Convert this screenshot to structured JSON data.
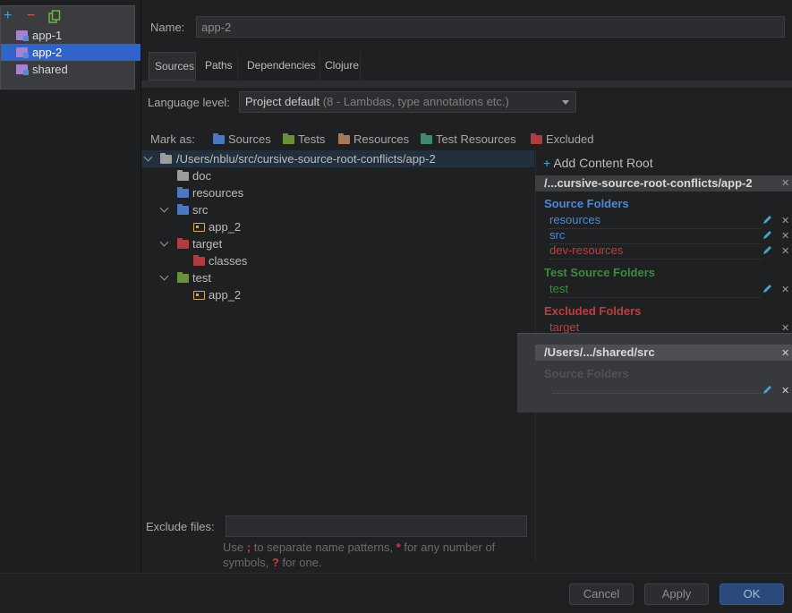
{
  "sidebar": {
    "add_glyph": "+",
    "remove_glyph": "−",
    "modules": [
      {
        "label": "app-1",
        "selected": false
      },
      {
        "label": "app-2",
        "selected": true
      },
      {
        "label": "shared",
        "selected": false
      }
    ]
  },
  "header": {
    "name_label": "Name:",
    "name_value": "app-2"
  },
  "tabs": [
    "Sources",
    "Paths",
    "Dependencies",
    "Clojure"
  ],
  "language": {
    "label": "Language level:",
    "value": "Project default",
    "hint": "(8 - Lambdas, type annotations etc.)"
  },
  "mark_as": {
    "label": "Mark as:",
    "sources": "Sources",
    "tests": "Tests",
    "resources": "Resources",
    "test_resources": "Test Resources",
    "excluded": "Excluded"
  },
  "tree": {
    "root": "/Users/nblu/src/cursive-source-root-conflicts/app-2",
    "doc": "doc",
    "resources": "resources",
    "src": "src",
    "src_pkg": "app_2",
    "target": "target",
    "classes": "classes",
    "test": "test",
    "test_pkg": "app_2"
  },
  "content_roots": {
    "add_label": "Add Content Root",
    "root1": {
      "path": "/...cursive-source-root-conflicts/app-2",
      "source_title": "Source Folders",
      "sources": [
        "resources",
        "src",
        "dev-resources"
      ],
      "test_title": "Test Source Folders",
      "tests": [
        "test"
      ],
      "excluded_title": "Excluded Folders",
      "excluded": [
        "target"
      ]
    },
    "root2": {
      "path": "/Users/.../shared/src",
      "source_title": "Source Folders"
    }
  },
  "exclude": {
    "label": "Exclude files:",
    "help_1": "Use",
    "sep": ";",
    "help_2": "to separate name patterns,",
    "star": "*",
    "help_3": "for any number of",
    "help_4": "symbols,",
    "q": "?",
    "help_5": "for one."
  },
  "buttons": {
    "cancel": "Cancel",
    "apply": "Apply",
    "ok": "OK"
  },
  "colors": {
    "accent": "#2f65ca",
    "sources_blue": "#4a88e0",
    "tests_green": "#3f8a3f",
    "excluded_red": "#c13d3d",
    "resources_brown": "#a5795a"
  }
}
